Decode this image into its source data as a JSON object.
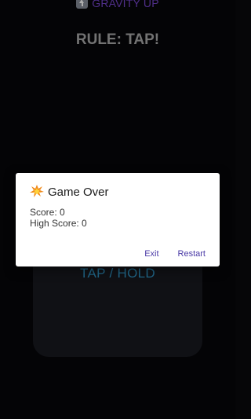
{
  "banner": {
    "icon": "up-arrow-icon",
    "text": "GRAVITY UP",
    "color": "#6b3fb8"
  },
  "rule": {
    "text": "RULE: TAP!"
  },
  "play_area": {
    "label": "TAP / HOLD",
    "label_color": "#2b88b5"
  },
  "dialog": {
    "icon": "explosion-icon",
    "title": "Game Over",
    "score_label": "Score:",
    "score_value": "0",
    "high_score_label": "High Score:",
    "high_score_value": "0",
    "exit_label": "Exit",
    "restart_label": "Restart",
    "action_color": "#4a3aa6"
  }
}
